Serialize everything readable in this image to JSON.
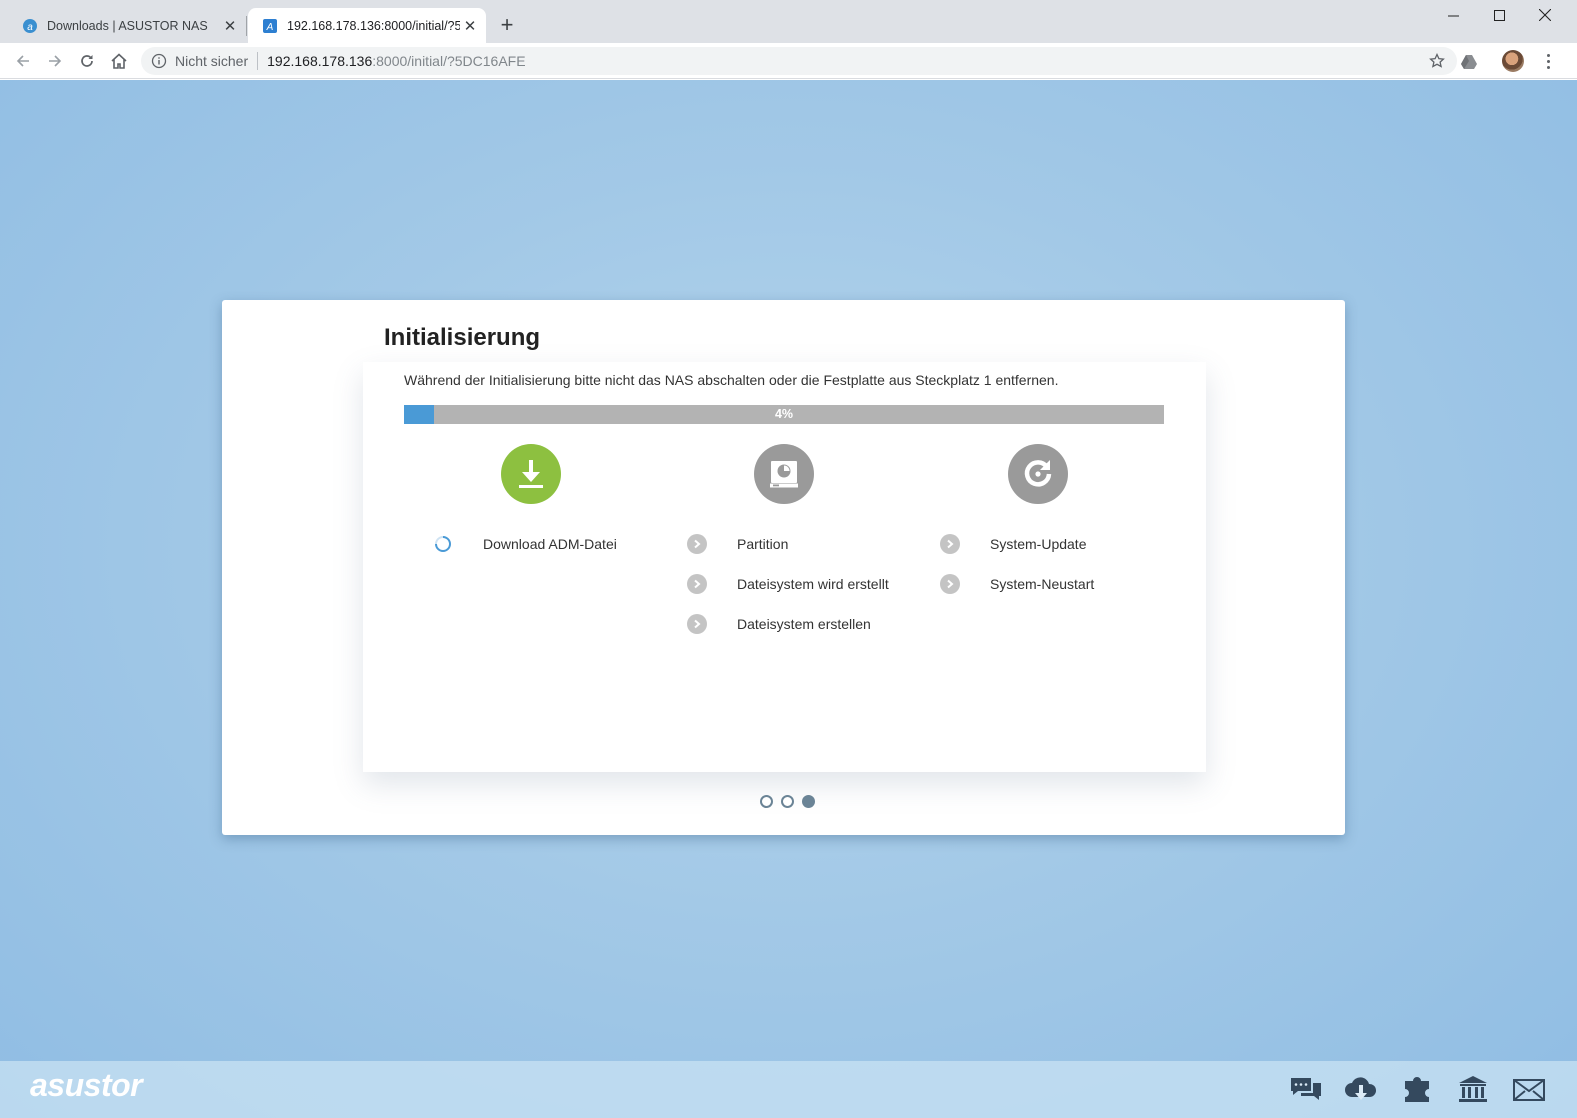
{
  "browser": {
    "tabs": [
      {
        "title": "Downloads | ASUSTOR NAS",
        "active": false
      },
      {
        "title": "192.168.178.136:8000/initial/?5DC16AFE",
        "active": true
      }
    ],
    "address": {
      "security_label": "Nicht sicher",
      "host": "192.168.178.136",
      "rest": ":8000/initial/?5DC16AFE"
    }
  },
  "card": {
    "title": "Initialisierung",
    "notice": "Während der Initialisierung bitte nicht das NAS abschalten oder die Festplatte aus Steckplatz 1 entfernen.",
    "progress": {
      "value": 4,
      "label": "4%"
    },
    "stages": [
      {
        "icon": "download-icon",
        "state": "active",
        "steps": [
          {
            "label": "Download ADM-Datei",
            "status": "in-progress"
          }
        ]
      },
      {
        "icon": "hard-disk-icon",
        "state": "pending",
        "steps": [
          {
            "label": "Partition",
            "status": "pending"
          },
          {
            "label": "Dateisystem wird erstellt",
            "status": "pending"
          },
          {
            "label": "Dateisystem erstellen",
            "status": "pending"
          }
        ]
      },
      {
        "icon": "restart-icon",
        "state": "pending",
        "steps": [
          {
            "label": "System-Update",
            "status": "pending"
          },
          {
            "label": "System-Neustart",
            "status": "pending"
          }
        ]
      }
    ],
    "pager": {
      "pages": 3,
      "current": 3
    }
  },
  "footer": {
    "brand": "asustor",
    "icons": [
      "chat-icon",
      "cloud-download-icon",
      "plugin-icon",
      "bank-icon",
      "mail-icon"
    ]
  },
  "colors": {
    "accent": "#4a9ad6",
    "done_green": "#8dc040",
    "pending_gray": "#9a9a9a",
    "background": "#a3c9e7"
  }
}
